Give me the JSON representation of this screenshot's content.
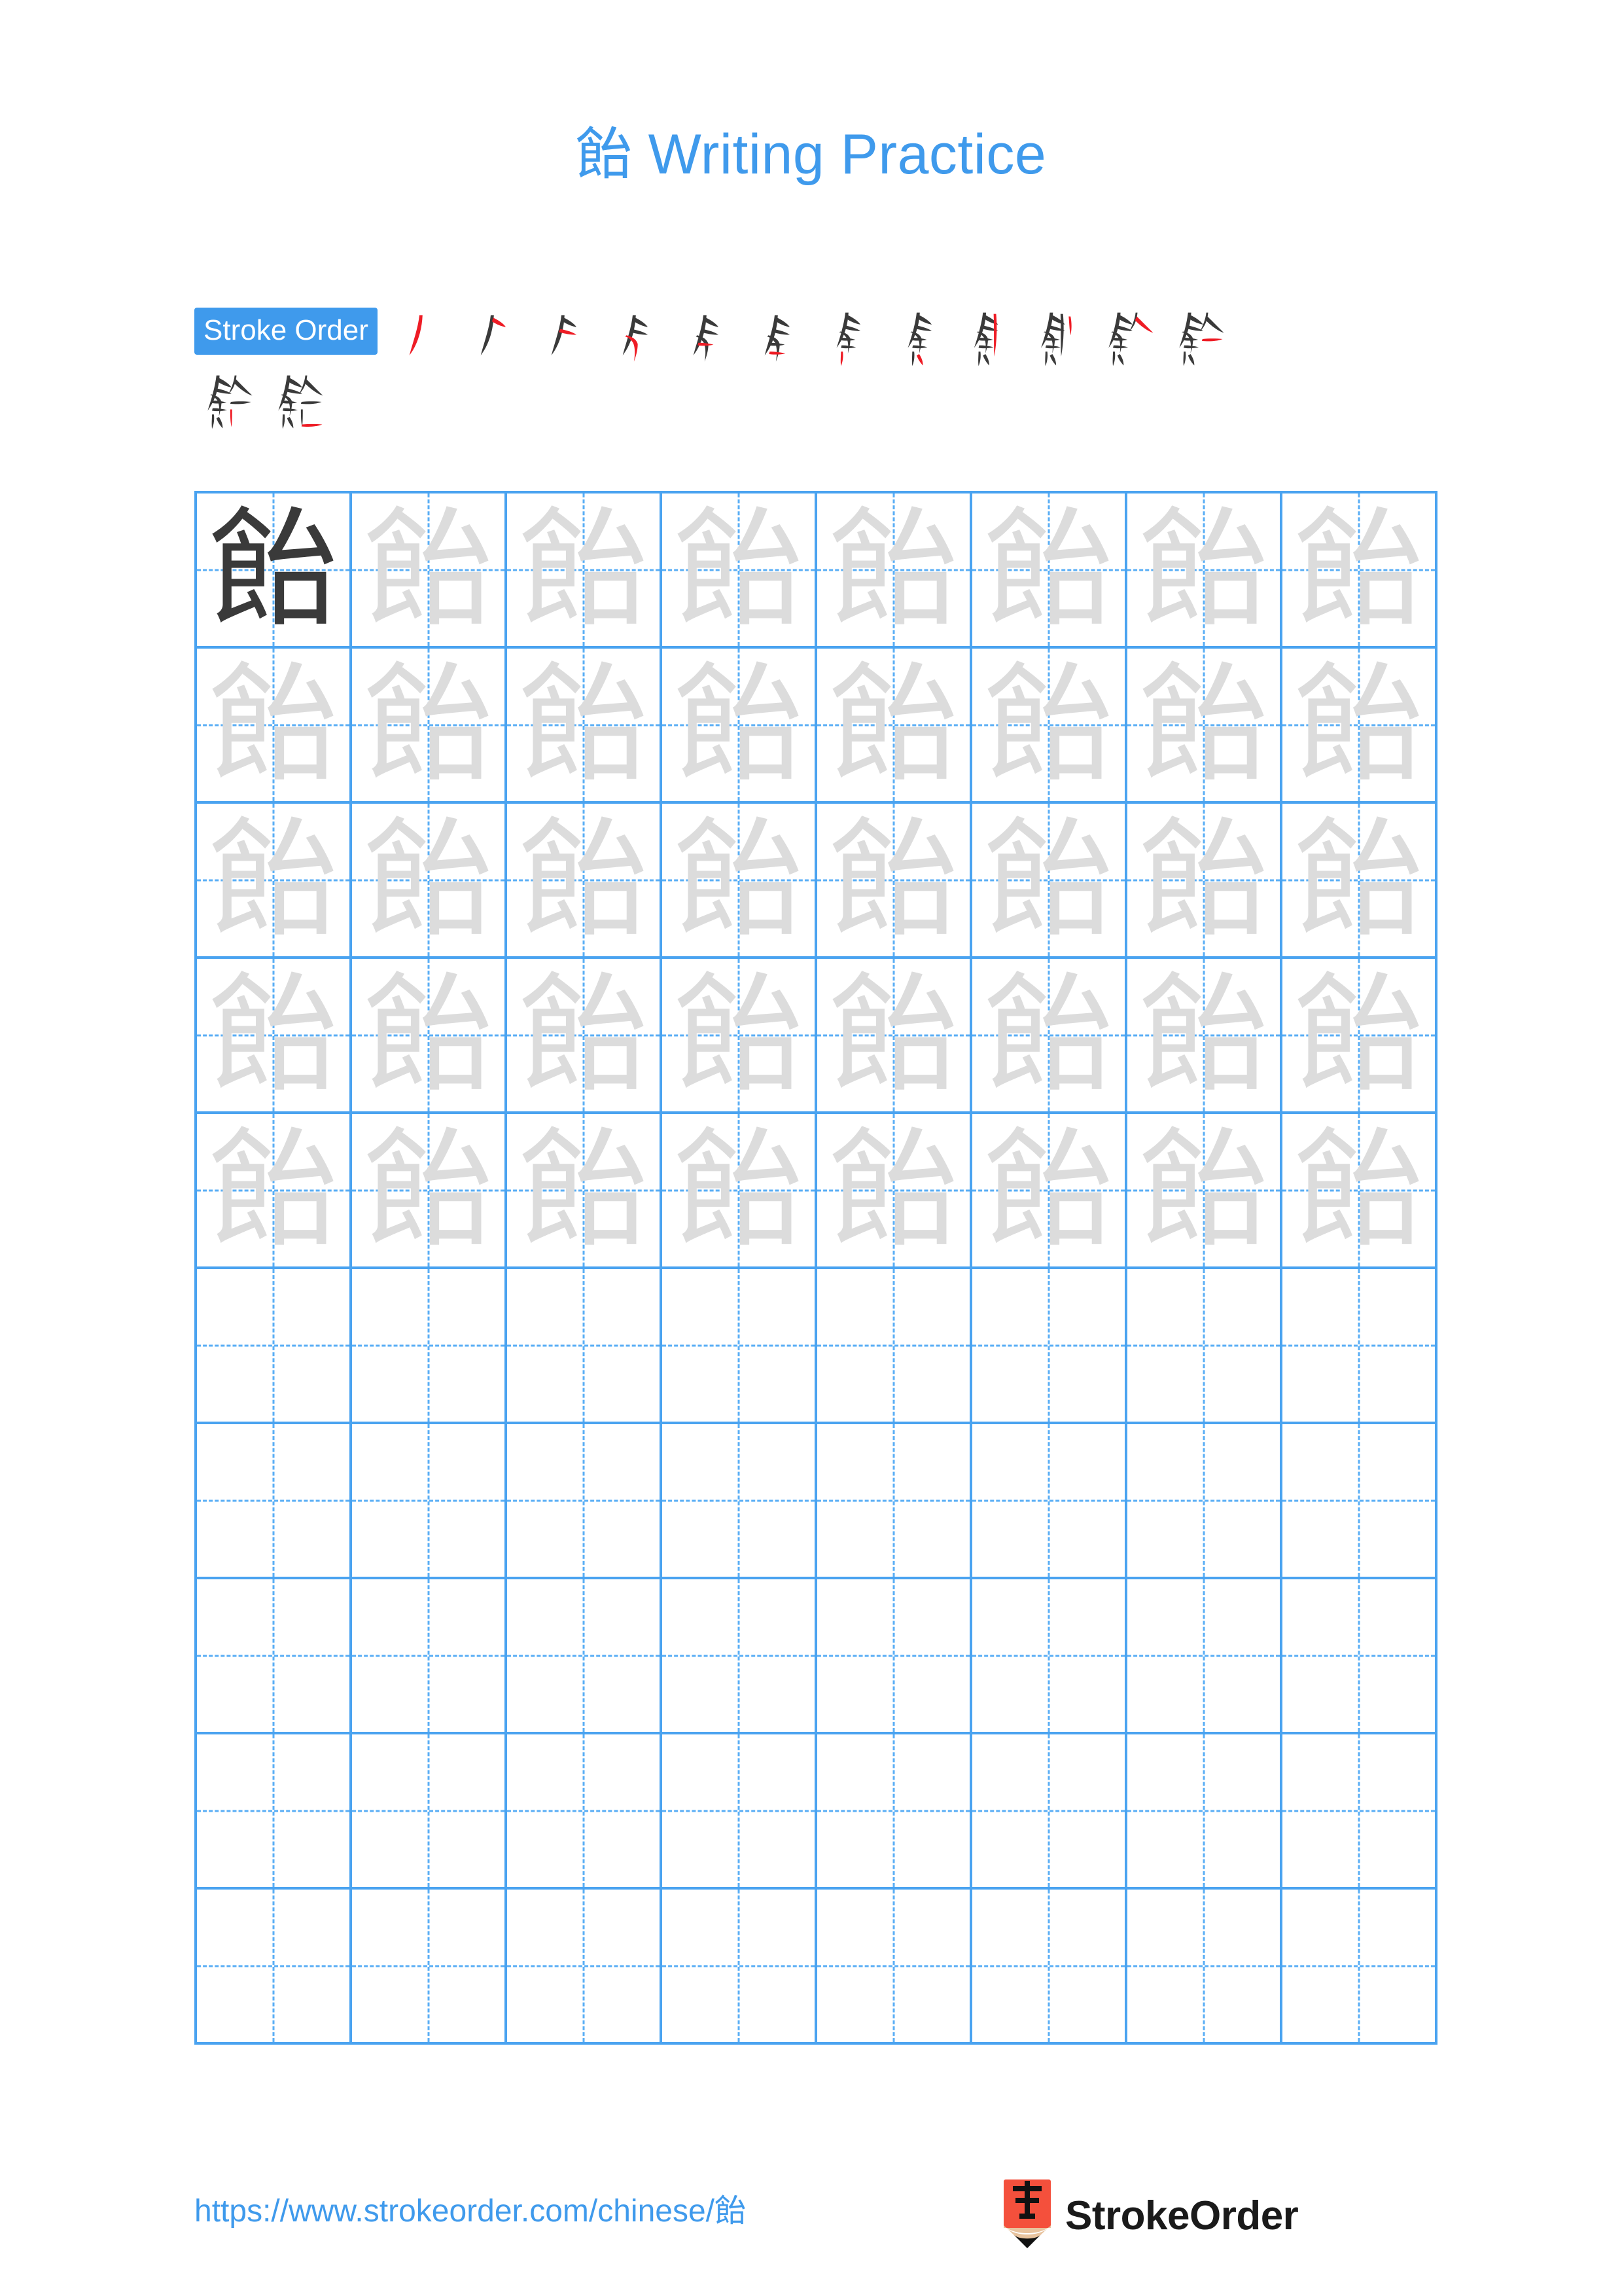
{
  "meta": {
    "character": "飴",
    "title": "飴 Writing Practice",
    "title_suffix": " Writing Practice"
  },
  "colors": {
    "accent_blue": "#3f9aec",
    "grid_blue": "#4aa3f0",
    "guide_blue": "#59aef5",
    "stroke_black": "#3a3a3a",
    "stroke_red": "#ee1c25",
    "trace_gray": "#dcdcdc",
    "logo_red": "#f4503c",
    "logo_wood": "#e8c39e"
  },
  "stroke_order": {
    "label": "Stroke Order",
    "total_strokes": 14,
    "steps": [
      {
        "index": 1,
        "partial": "丿"
      },
      {
        "index": 2,
        "partial": "𠂉"
      },
      {
        "index": 3,
        "partial": "𠂉"
      },
      {
        "index": 4,
        "partial": "乍"
      },
      {
        "index": 5,
        "partial": "今"
      },
      {
        "index": 6,
        "partial": "彑"
      },
      {
        "index": 7,
        "partial": "𠔼"
      },
      {
        "index": 8,
        "partial": "良"
      },
      {
        "index": 9,
        "partial": "食"
      },
      {
        "index": 10,
        "partial": "飠"
      },
      {
        "index": 11,
        "partial": "飠"
      },
      {
        "index": 12,
        "partial": "飠"
      },
      {
        "index": 13,
        "partial": "飴"
      },
      {
        "index": 14,
        "partial": "飴"
      }
    ],
    "row_breaks": [
      12
    ]
  },
  "practice_grid": {
    "columns": 8,
    "rows": 10,
    "traced_rows": 5,
    "blank_rows": 5,
    "cell_char": "飴",
    "first_cell_is_dark": true
  },
  "footer": {
    "url": "https://www.strokeorder.com/chinese/飴",
    "brand_name": "StrokeOrder",
    "logo_glyph": "字"
  }
}
